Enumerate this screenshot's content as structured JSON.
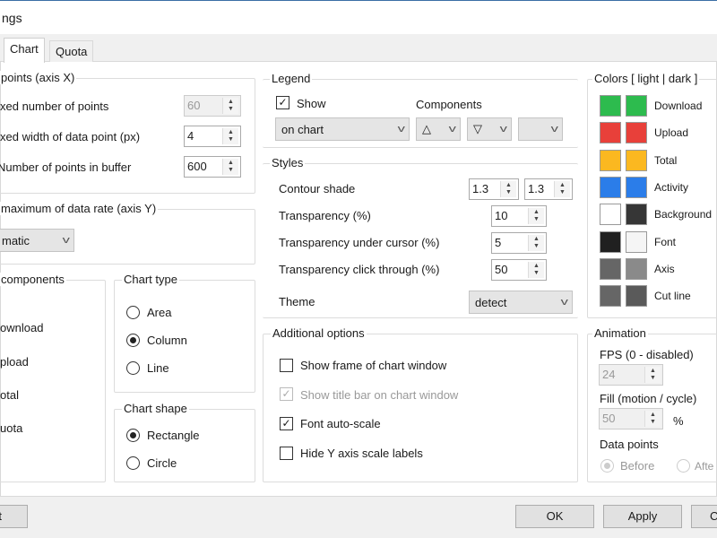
{
  "window": {
    "title": "ngs"
  },
  "tabs": [
    {
      "label": "Chart",
      "active": true
    },
    {
      "label": "Quota",
      "active": false
    }
  ],
  "points_x": {
    "title": "points (axis X)",
    "fixed_number": {
      "label": "xed number of points",
      "value": "60",
      "disabled": true
    },
    "fixed_width": {
      "label": "xed width of data point (px)",
      "value": "4"
    },
    "buffer": {
      "label": "Number of points in buffer",
      "value": "600"
    }
  },
  "max_rate": {
    "title": "maximum of data rate (axis Y)",
    "value": "matic"
  },
  "components": {
    "title": "components",
    "items": [
      "ownload",
      "pload",
      "otal",
      "uota"
    ]
  },
  "chart_type": {
    "title": "Chart type",
    "options": [
      "Area",
      "Column",
      "Line"
    ],
    "selected": "Column"
  },
  "chart_shape": {
    "title": "Chart shape",
    "options": [
      "Rectangle",
      "Circle"
    ],
    "selected": "Rectangle"
  },
  "legend": {
    "title": "Legend",
    "show_label": "Show",
    "show": true,
    "position": "on chart",
    "components_label": "Components",
    "comp1": "△",
    "comp2": "▽",
    "comp3": ""
  },
  "styles": {
    "title": "Styles",
    "contour_label": "Contour shade",
    "contour1": "1.3",
    "contour2": "1.3",
    "transparency_label": "Transparency (%)",
    "transparency": "10",
    "under_cursor_label": "Transparency under cursor (%)",
    "under_cursor": "5",
    "click_through_label": "Transparency click through (%)",
    "click_through": "50",
    "theme_label": "Theme",
    "theme": "detect"
  },
  "additional": {
    "title": "Additional options",
    "items": [
      {
        "label": "Show frame of chart window",
        "checked": false,
        "disabled": false
      },
      {
        "label": "Show title bar on chart window",
        "checked": true,
        "disabled": true
      },
      {
        "label": "Font auto-scale",
        "checked": true,
        "disabled": false
      },
      {
        "label": "Hide Y axis scale labels",
        "checked": false,
        "disabled": false
      }
    ]
  },
  "colors": {
    "title": "Colors [ light | dark ]",
    "items": [
      {
        "label": "Download",
        "light": "#2dbb4e",
        "dark": "#2dbb4e"
      },
      {
        "label": "Upload",
        "light": "#e8403a",
        "dark": "#e8403a"
      },
      {
        "label": "Total",
        "light": "#fbb820",
        "dark": "#fbb820"
      },
      {
        "label": "Activity",
        "light": "#2b7de9",
        "dark": "#2b7de9"
      },
      {
        "label": "Background",
        "light": "#ffffff",
        "dark": "#363636"
      },
      {
        "label": "Font",
        "light": "#202020",
        "dark": "#f5f5f5"
      },
      {
        "label": "Axis",
        "light": "#666666",
        "dark": "#8a8a8a"
      },
      {
        "label": "Cut line",
        "light": "#666666",
        "dark": "#5a5a5a"
      }
    ]
  },
  "animation": {
    "title": "Animation",
    "fps_label": "FPS (0 - disabled)",
    "fps": "24",
    "fill_label": "Fill (motion / cycle)",
    "fill": "50",
    "fill_unit": "%",
    "points_label": "Data points",
    "before": "Before",
    "after": "Afte"
  },
  "buttons": {
    "left": "t",
    "ok": "OK",
    "apply": "Apply",
    "cancel": "C"
  }
}
